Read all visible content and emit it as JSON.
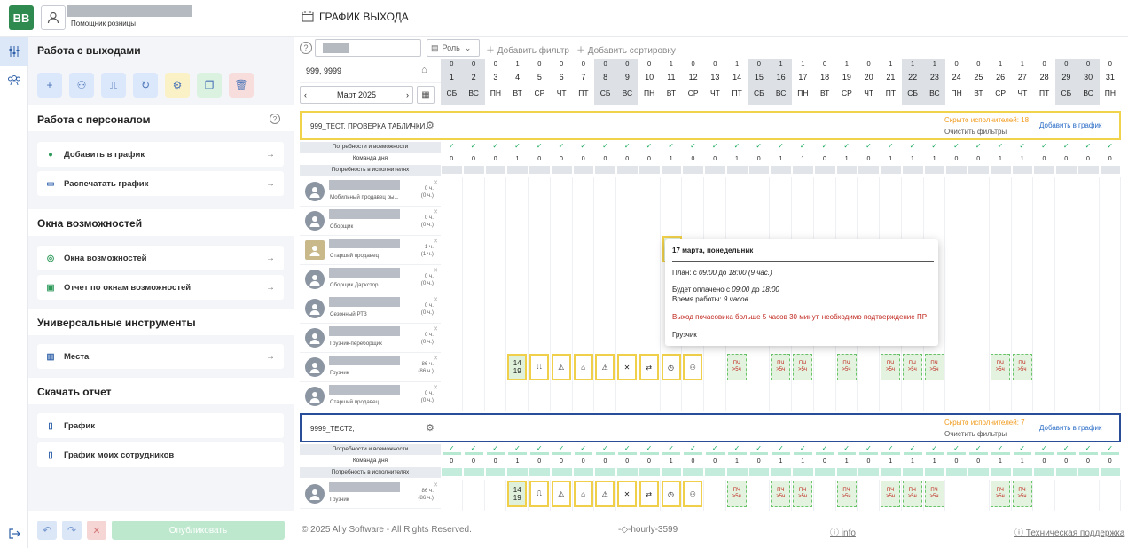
{
  "topbar": {
    "logo": "BB",
    "user_name_hidden": "",
    "user_role": "Помощник розницы",
    "page_title": "ГРАФИК ВЫХОДА"
  },
  "filters": {
    "search_placeholder": "",
    "role_label": "Роль",
    "add_filter": "Добавить фильтр",
    "add_sort": "Добавить сортировку"
  },
  "panel": {
    "sec1": "Работа с выходами",
    "tools": [
      {
        "icon": "plus-icon",
        "color": "#dbe7fa"
      },
      {
        "icon": "users-icon",
        "color": "#dbe7fa"
      },
      {
        "icon": "stamp-icon",
        "color": "#dbe7fa"
      },
      {
        "icon": "refresh-icon",
        "color": "#dbe7fa"
      },
      {
        "icon": "gear-icon",
        "color": "#fbf1c7"
      },
      {
        "icon": "copy-icon",
        "color": "#dbf2e1"
      },
      {
        "icon": "trash-icon",
        "color": "#f8dddd"
      }
    ],
    "sec2": "Работа с персоналом",
    "sec2_items": [
      "Добавить в график",
      "Распечатать график"
    ],
    "sec3": "Окна возможностей",
    "sec3_items": [
      "Окна возможностей",
      "Отчет по окнам возможностей"
    ],
    "sec4": "Универсальные инструменты",
    "sec4_items": [
      "Места"
    ],
    "sec5": "Скачать отчет",
    "sec5_items": [
      "График",
      "График моих сотрудников"
    ],
    "publish": "Опубликовать"
  },
  "calendar": {
    "store": "999, 9999",
    "month": "Март 2025",
    "days": [
      {
        "n": 1,
        "w": "СБ",
        "c": 0,
        "we": true
      },
      {
        "n": 2,
        "w": "ВС",
        "c": 0,
        "we": true
      },
      {
        "n": 3,
        "w": "ПН",
        "c": 0
      },
      {
        "n": 4,
        "w": "ВТ",
        "c": 1
      },
      {
        "n": 5,
        "w": "СР",
        "c": 0
      },
      {
        "n": 6,
        "w": "ЧТ",
        "c": 0
      },
      {
        "n": 7,
        "w": "ПТ",
        "c": 0
      },
      {
        "n": 8,
        "w": "СБ",
        "c": 0,
        "we": true
      },
      {
        "n": 9,
        "w": "ВС",
        "c": 0,
        "we": true
      },
      {
        "n": 10,
        "w": "ПН",
        "c": 0
      },
      {
        "n": 11,
        "w": "ВТ",
        "c": 1
      },
      {
        "n": 12,
        "w": "СР",
        "c": 0
      },
      {
        "n": 13,
        "w": "ЧТ",
        "c": 0
      },
      {
        "n": 14,
        "w": "ПТ",
        "c": 1
      },
      {
        "n": 15,
        "w": "СБ",
        "c": 0,
        "we": true
      },
      {
        "n": 16,
        "w": "ВС",
        "c": 1,
        "we": true
      },
      {
        "n": 17,
        "w": "ПН",
        "c": 1
      },
      {
        "n": 18,
        "w": "ВТ",
        "c": 0
      },
      {
        "n": 19,
        "w": "СР",
        "c": 1
      },
      {
        "n": 20,
        "w": "ЧТ",
        "c": 0
      },
      {
        "n": 21,
        "w": "ПТ",
        "c": 1
      },
      {
        "n": 22,
        "w": "СБ",
        "c": 1,
        "we": true
      },
      {
        "n": 23,
        "w": "ВС",
        "c": 1,
        "we": true
      },
      {
        "n": 24,
        "w": "ПН",
        "c": 0
      },
      {
        "n": 25,
        "w": "ВТ",
        "c": 0
      },
      {
        "n": 26,
        "w": "СР",
        "c": 1
      },
      {
        "n": 27,
        "w": "ЧТ",
        "c": 1
      },
      {
        "n": 28,
        "w": "ПТ",
        "c": 0
      },
      {
        "n": 29,
        "w": "СБ",
        "c": 0,
        "we": true
      },
      {
        "n": 30,
        "w": "ВС",
        "c": 0,
        "we": true
      },
      {
        "n": 31,
        "w": "ПН",
        "c": 0
      }
    ]
  },
  "group1": {
    "name": "999_ТЕСТ, ПРОВЕРКА ТАБЛИЧКИ.",
    "hidden": "Скрыто исполнителей: 18",
    "clear": "Очистить фильтры",
    "add": "Добавить в график"
  },
  "group2": {
    "name": "9999_ТЕСТ2,",
    "hidden": "Скрыто исполнителей: 7",
    "clear": "Очистить фильтры",
    "add": "Добавить в график"
  },
  "rows": {
    "needs": "Потребности и возможности",
    "team": "Команда дня",
    "need_exec": "Потребность в исполнителях"
  },
  "employees1": [
    {
      "role": "Мобильный продавец ры...",
      "h": "0 ч.",
      "h2": "(0 ч.)"
    },
    {
      "role": "Сборщик",
      "h": "0 ч.",
      "h2": "(0 ч.)"
    },
    {
      "role": "Старший продавец",
      "h": "1 ч.",
      "h2": "(1 ч.)"
    },
    {
      "role": "Сборщик Даркстор",
      "h": "0 ч.",
      "h2": "(0 ч.)"
    },
    {
      "role": "Сезонный РТЗ",
      "h": "0 ч.",
      "h2": "(0 ч.)"
    },
    {
      "role": "Грузчик-переборщик",
      "h": "0 ч.",
      "h2": "(0 ч.)"
    },
    {
      "role": "Грузчик",
      "h": "86 ч.",
      "h2": "(86 ч.)"
    },
    {
      "role": "Старший продавец",
      "h": "0 ч.",
      "h2": "(0 ч.)"
    }
  ],
  "employees2": [
    {
      "role": "Грузчик",
      "h": "86 ч.",
      "h2": "(86 ч.)"
    }
  ],
  "shift": {
    "start": "14",
    "end": "19"
  },
  "pch": {
    "a": "ПЧ",
    "b": ">5ч"
  },
  "tooltip": {
    "date": "17 марта, понедельник",
    "plan_prefix": "План: с",
    "plan_from": "09:00",
    "plan_mid": "до",
    "plan_to": "18:00",
    "plan_dur": "(9 час.)",
    "paid_prefix": "Будет оплачено с",
    "paid_from": "09:00",
    "paid_mid": "до",
    "paid_to": "18:00",
    "work_prefix": "Время работы:",
    "work_val": "9 часов",
    "warn": "Выход почасовика больше 5 часов 30 минут, необходимо подтверждение ПР",
    "role": "Грузчик"
  },
  "footer": {
    "copy": "© 2025 Ally Software - All Rights Reserved.",
    "build": "-◇-hourly-3599",
    "info": "info",
    "support": "Техническая поддержка"
  }
}
